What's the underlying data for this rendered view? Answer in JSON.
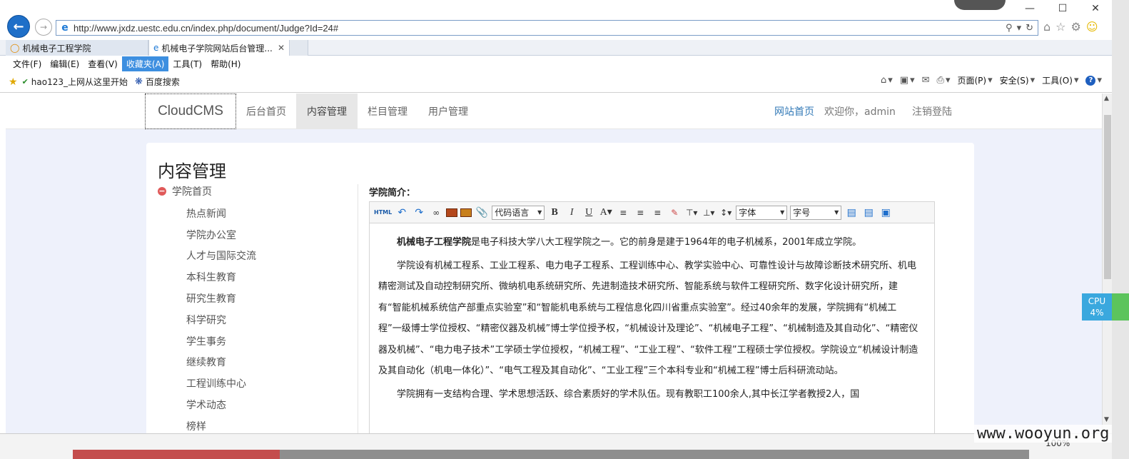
{
  "browser": {
    "address_url": "http://www.jxdz.uestc.edu.cn/index.php/document/Judge?Id=24#",
    "tabs": [
      {
        "label": "机械电子工程学院"
      },
      {
        "label": "机械电子学院网站后台管理..."
      }
    ],
    "menu": [
      "文件(F)",
      "编辑(E)",
      "查看(V)",
      "收藏夹(A)",
      "工具(T)",
      "帮助(H)"
    ],
    "favorites": [
      "hao123_上网从这里开始",
      "百度搜索"
    ],
    "commands": [
      "页面(P)",
      "安全(S)",
      "工具(O)"
    ],
    "zoom": "100%"
  },
  "site": {
    "brand": "CloudCMS",
    "nav": [
      "后台首页",
      "内容管理",
      "栏目管理",
      "用户管理"
    ],
    "active_nav": "内容管理",
    "home_link": "网站首页",
    "welcome": "欢迎你，admin",
    "logout": "注销登陆"
  },
  "panel": {
    "title": "内容管理",
    "sidebar_root": "学院首页",
    "sidebar_items": [
      "热点新闻",
      "学院办公室",
      "人才与国际交流",
      "本科生教育",
      "研究生教育",
      "科学研究",
      "学生事务",
      "继续教育",
      "工程训练中心",
      "学术动态",
      "榜样"
    ],
    "field_label": "学院简介：",
    "toolbar": {
      "html": "HTML",
      "code_select": "代码语言",
      "font_select": "字体",
      "size_select": "字号"
    },
    "content": {
      "p1_bold": "机械电子工程学院",
      "p1_rest": "是电子科技大学八大工程学院之一。它的前身是建于1964年的电子机械系，2001年成立学院。",
      "p2": "学院设有机械工程系、工业工程系、电力电子工程系、工程训练中心、教学实验中心、可靠性设计与故障诊断技术研究所、机电精密测试及自动控制研究所、微纳机电系统研究所、先进制造技术研究所、智能系统与软件工程研究所、数字化设计研究所，建有“智能机械系统信产部重点实验室”和“智能机电系统与工程信息化四川省重点实验室”。经过40余年的发展，学院拥有“机械工程”一级博士学位授权、“精密仪器及机械”博士学位授予权，“机械设计及理论”、“机械电子工程”、“机械制造及其自动化”、“精密仪器及机械”、“电力电子技术”工学硕士学位授权，“机械工程”、“工业工程”、“软件工程”工程硕士学位授权。学院设立“机械设计制造及其自动化（机电一体化）”、“电气工程及其自动化”、“工业工程”三个本科专业和“机械工程”博士后科研流动站。",
      "p3": "学院拥有一支结构合理、学术思想活跃、综合素质好的学术队伍。现有教职工100余人,其中长江学者教授2人，国"
    }
  },
  "overlay": {
    "cpu_label": "CPU",
    "cpu_value": "4%",
    "watermark": "www.wooyun.org"
  }
}
